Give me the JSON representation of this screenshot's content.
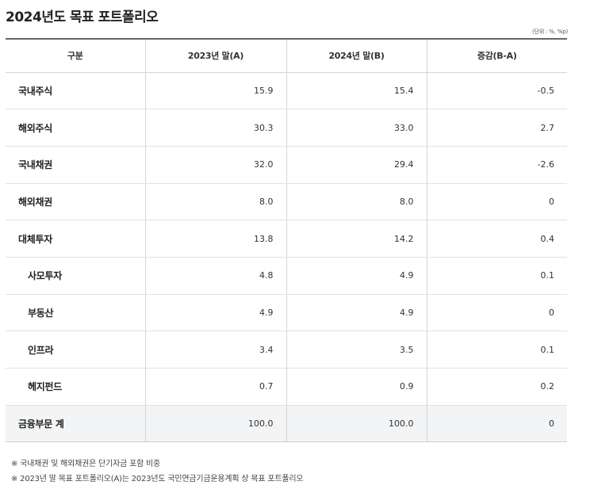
{
  "title": "2024년도 목표 포트폴리오",
  "unit": "(단위 : %, %p)",
  "table": {
    "headers": [
      "구분",
      "2023년 말(A)",
      "2024년 말(B)",
      "증감(B-A)"
    ],
    "rows": [
      {
        "label": "국내주식",
        "a": "15.9",
        "b": "15.4",
        "diff": "-0.5"
      },
      {
        "label": "해외주식",
        "a": "30.3",
        "b": "33.0",
        "diff": "2.7"
      },
      {
        "label": "국내채권",
        "a": "32.0",
        "b": "29.4",
        "diff": "-2.6"
      },
      {
        "label": "해외채권",
        "a": "8.0",
        "b": "8.0",
        "diff": "0"
      },
      {
        "label": "대체투자",
        "a": "13.8",
        "b": "14.2",
        "diff": "0.4"
      },
      {
        "label": "사모투자",
        "a": "4.8",
        "b": "4.9",
        "diff": "0.1"
      },
      {
        "label": "부동산",
        "a": "4.9",
        "b": "4.9",
        "diff": "0"
      },
      {
        "label": "인프라",
        "a": "3.4",
        "b": "3.5",
        "diff": "0.1"
      },
      {
        "label": "헤지펀드",
        "a": "0.7",
        "b": "0.9",
        "diff": "0.2"
      },
      {
        "label": "금융부문 계",
        "a": "100.0",
        "b": "100.0",
        "diff": "0"
      }
    ]
  },
  "notes": [
    "※  국내채권 및 해외채권은 단기자금 포함 비중",
    "※  2023년 말 목표 포트폴리오(A)는 2023년도 국민연금기금운용계획 상 목표 포트폴리오"
  ]
}
